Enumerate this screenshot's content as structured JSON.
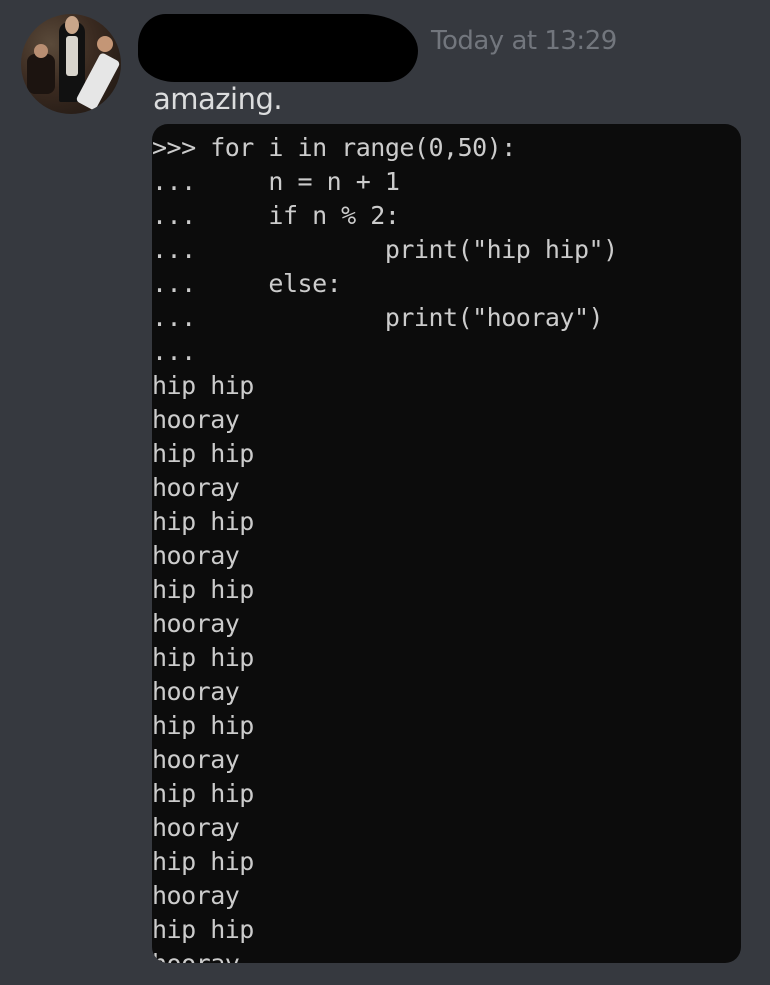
{
  "message": {
    "author_redacted": true,
    "timestamp": "Today at 13:29",
    "text": "amazing.",
    "avatar": "avatar-image"
  },
  "code_block": {
    "lines": [
      ">>> for i in range(0,50):",
      "...     n = n + 1",
      "...     if n % 2:",
      "...             print(\"hip hip\")",
      "...     else:",
      "...             print(\"hooray\")",
      "...",
      "hip hip",
      "hooray",
      "hip hip",
      "hooray",
      "hip hip",
      "hooray",
      "hip hip",
      "hooray",
      "hip hip",
      "hooray",
      "hip hip",
      "hooray",
      "hip hip",
      "hooray",
      "hip hip",
      "hooray",
      "hip hip",
      "hooray"
    ]
  }
}
